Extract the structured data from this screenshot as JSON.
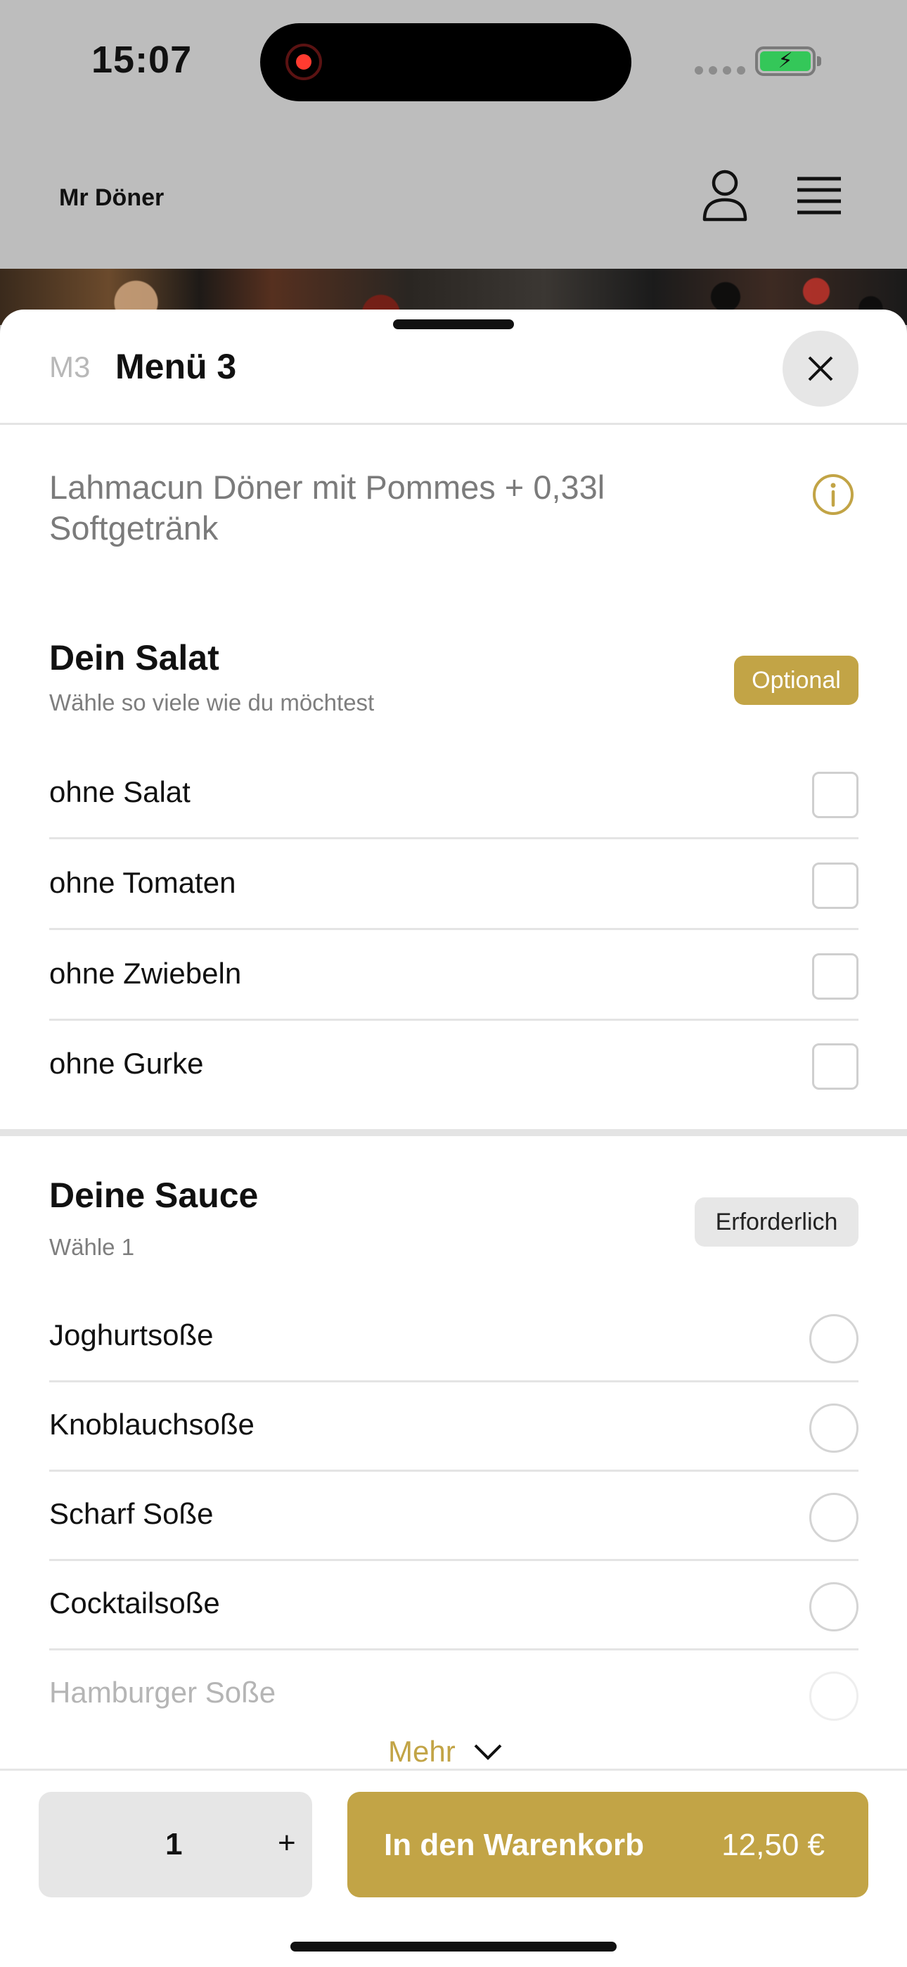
{
  "status_bar": {
    "time": "15:07"
  },
  "app": {
    "brand": "Mr Döner"
  },
  "sheet": {
    "code": "M3",
    "title": "Menü 3",
    "description": "Lahmacun Döner mit Pommes + 0,33l Softgetränk"
  },
  "salad_group": {
    "title": "Dein Salat",
    "subtitle": "Wähle so viele wie du möchtest",
    "badge": "Optional",
    "options": [
      {
        "label": "ohne Salat",
        "checked": false
      },
      {
        "label": "ohne Tomaten",
        "checked": false
      },
      {
        "label": "ohne Zwiebeln",
        "checked": false
      },
      {
        "label": "ohne Gurke",
        "checked": false
      }
    ]
  },
  "sauce_group": {
    "title": "Deine Sauce",
    "subtitle": "Wähle 1",
    "badge": "Erforderlich",
    "options": [
      {
        "label": "Joghurtsoße",
        "selected": false
      },
      {
        "label": "Knoblauchsoße",
        "selected": false
      },
      {
        "label": "Scharf Soße",
        "selected": false
      },
      {
        "label": "Cocktailsoße",
        "selected": false
      },
      {
        "label": "Hamburger Soße",
        "selected": false
      }
    ],
    "more_label": "Mehr"
  },
  "bottom_bar": {
    "quantity": "1",
    "plus": "+",
    "cart_label": "In den Warenkorb",
    "price": "12,50 €"
  },
  "colors": {
    "accent": "#c2a446",
    "badge_required_bg": "#e7e7e7",
    "backdrop": "#bdbdbd"
  },
  "icons": [
    "user-icon",
    "hamburger-menu-icon",
    "close-icon",
    "info-icon",
    "chevron-down-icon",
    "battery-icon",
    "record-icon"
  ]
}
